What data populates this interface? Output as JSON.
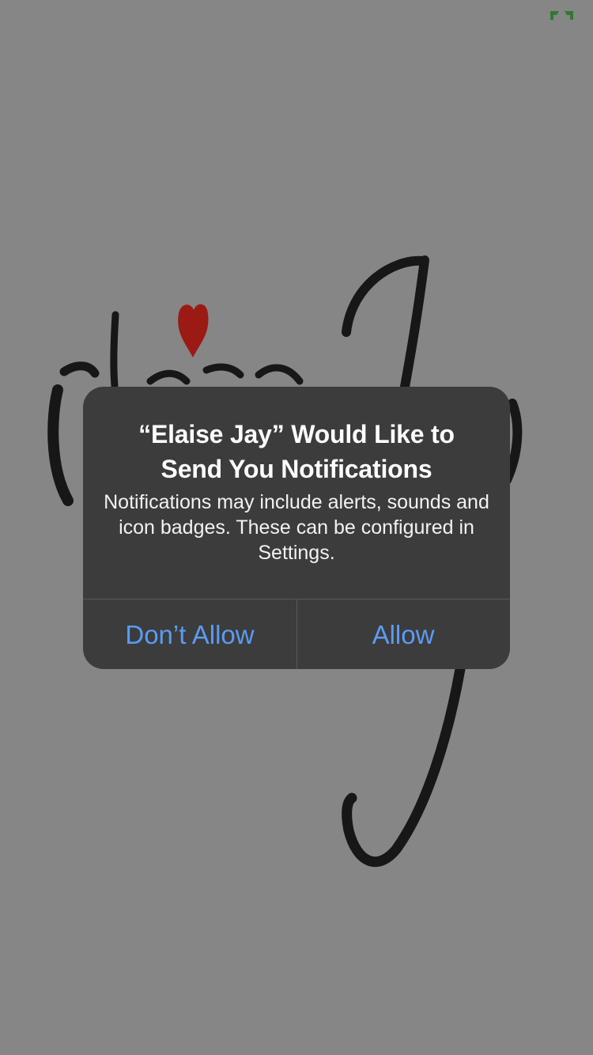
{
  "app": {
    "name": "Elaise Jay"
  },
  "status_bar": {
    "battery_icon": "battery-charging-icon",
    "battery_color": "#2f7a2f"
  },
  "splash": {
    "logo_icon": "elaise-jay-script-logo",
    "heart_color": "#9b1b14",
    "logo_color": "#171717"
  },
  "alert": {
    "title": "“Elaise Jay” Would Like to Send You Notifications",
    "message": "Notifications may include alerts, sounds and icon badges. These can be configured in Settings.",
    "deny_label": "Don’t Allow",
    "allow_label": "Allow"
  },
  "colors": {
    "background": "#868686",
    "alert_background": "#3c3c3c",
    "button_text": "#5b9bf3"
  }
}
